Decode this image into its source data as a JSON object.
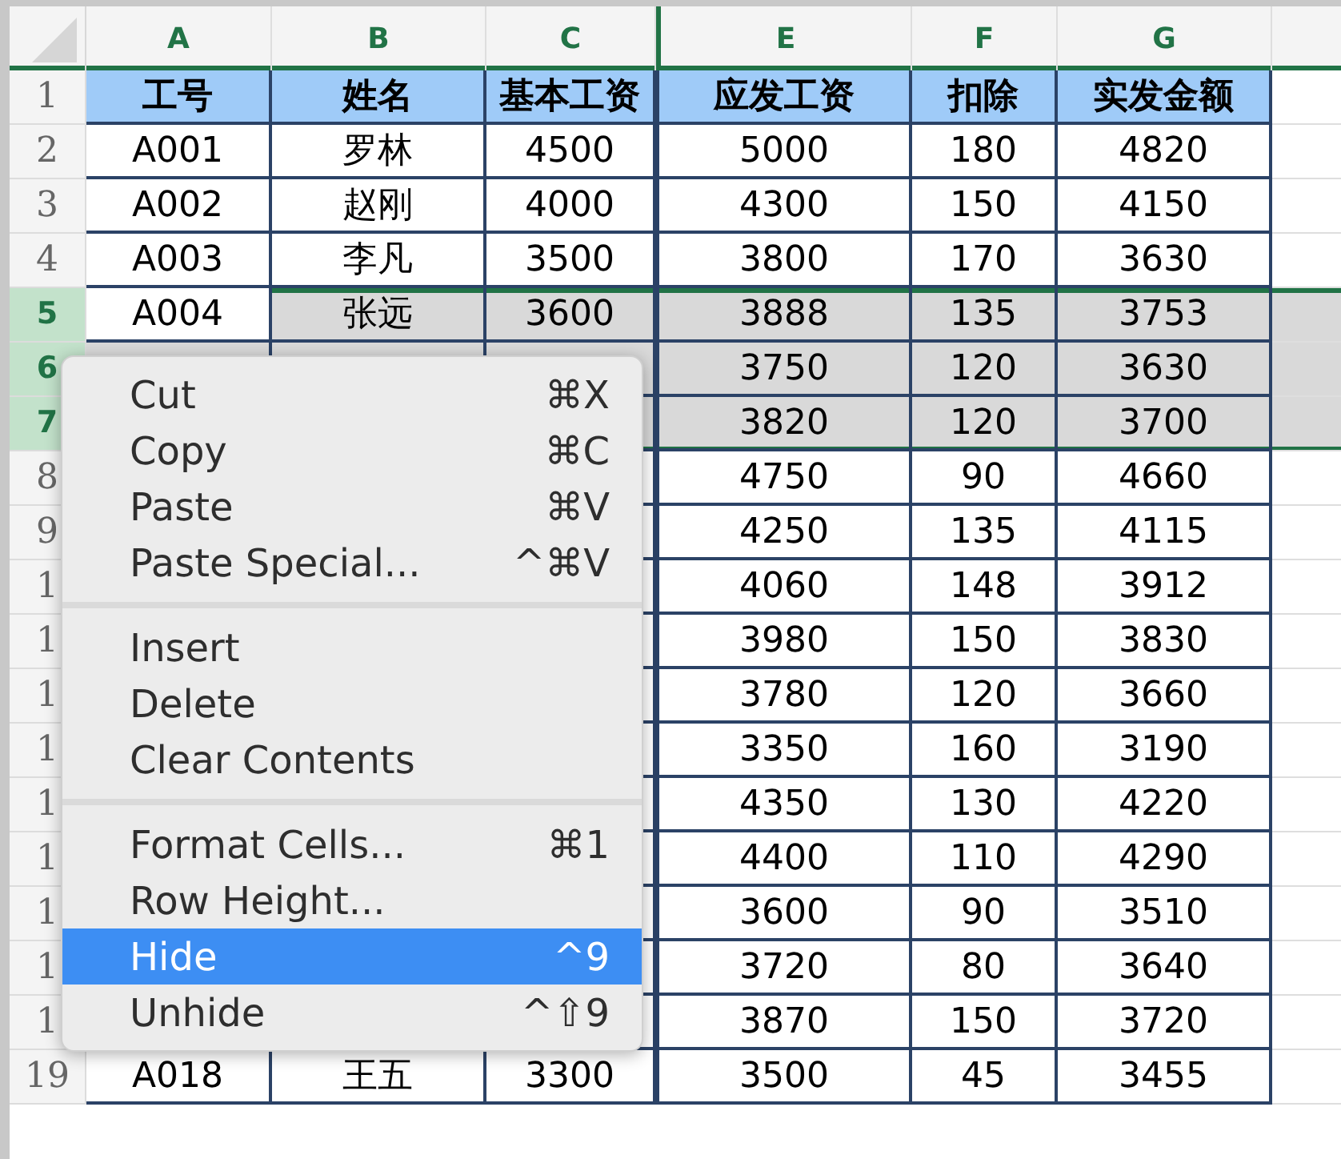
{
  "columns": [
    {
      "label": "A"
    },
    {
      "label": "B"
    },
    {
      "label": "C"
    },
    {
      "label": "E"
    },
    {
      "label": "F"
    },
    {
      "label": "G"
    }
  ],
  "rows": [
    {
      "number": "1",
      "selected": false,
      "heading": true,
      "active_cell": false,
      "cells": [
        "工号",
        "姓名",
        "基本工资",
        "应发工资",
        "扣除",
        "实发金额"
      ]
    },
    {
      "number": "2",
      "selected": false,
      "heading": false,
      "active_cell": false,
      "cells": [
        "A001",
        "罗林",
        "4500",
        "5000",
        "180",
        "4820"
      ]
    },
    {
      "number": "3",
      "selected": false,
      "heading": false,
      "active_cell": false,
      "cells": [
        "A002",
        "赵刚",
        "4000",
        "4300",
        "150",
        "4150"
      ]
    },
    {
      "number": "4",
      "selected": false,
      "heading": false,
      "active_cell": false,
      "cells": [
        "A003",
        "李凡",
        "3500",
        "3800",
        "170",
        "3630"
      ]
    },
    {
      "number": "5",
      "selected": true,
      "heading": false,
      "active_cell": true,
      "cells": [
        "A004",
        "张远",
        "3600",
        "3888",
        "135",
        "3753"
      ]
    },
    {
      "number": "6",
      "selected": true,
      "heading": false,
      "active_cell": false,
      "cells": [
        "3750",
        "120",
        "3630"
      ]
    },
    {
      "number": "7",
      "selected": true,
      "heading": false,
      "active_cell": false,
      "cells": [
        "3820",
        "120",
        "3700"
      ]
    },
    {
      "number": "8",
      "selected": false,
      "heading": false,
      "active_cell": false,
      "cells": [
        "4750",
        "90",
        "4660"
      ]
    },
    {
      "number": "9",
      "selected": false,
      "heading": false,
      "active_cell": false,
      "cells": [
        "4250",
        "135",
        "4115"
      ]
    },
    {
      "number": "1",
      "selected": false,
      "heading": false,
      "active_cell": false,
      "cells": [
        "4060",
        "148",
        "3912"
      ]
    },
    {
      "number": "1",
      "selected": false,
      "heading": false,
      "active_cell": false,
      "cells": [
        "3980",
        "150",
        "3830"
      ]
    },
    {
      "number": "1",
      "selected": false,
      "heading": false,
      "active_cell": false,
      "cells": [
        "3780",
        "120",
        "3660"
      ]
    },
    {
      "number": "1",
      "selected": false,
      "heading": false,
      "active_cell": false,
      "cells": [
        "3350",
        "160",
        "3190"
      ]
    },
    {
      "number": "1",
      "selected": false,
      "heading": false,
      "active_cell": false,
      "cells": [
        "4350",
        "130",
        "4220"
      ]
    },
    {
      "number": "1",
      "selected": false,
      "heading": false,
      "active_cell": false,
      "cells": [
        "4400",
        "110",
        "4290"
      ]
    },
    {
      "number": "1",
      "selected": false,
      "heading": false,
      "active_cell": false,
      "cells": [
        "3600",
        "90",
        "3510"
      ]
    },
    {
      "number": "1",
      "selected": false,
      "heading": false,
      "active_cell": false,
      "cells": [
        "3720",
        "80",
        "3640"
      ]
    },
    {
      "number": "1",
      "selected": false,
      "heading": false,
      "active_cell": false,
      "cells": [
        "3870",
        "150",
        "3720"
      ]
    },
    {
      "number": "19",
      "selected": false,
      "heading": false,
      "active_cell": false,
      "cells": [
        "A018",
        "王五",
        "3300",
        "3500",
        "45",
        "3455"
      ]
    }
  ],
  "context_menu": [
    {
      "kind": "item",
      "label": "Cut",
      "shortcut": "⌘X",
      "selected": false
    },
    {
      "kind": "item",
      "label": "Copy",
      "shortcut": "⌘C",
      "selected": false
    },
    {
      "kind": "item",
      "label": "Paste",
      "shortcut": "⌘V",
      "selected": false
    },
    {
      "kind": "item",
      "label": "Paste Special...",
      "shortcut": "^⌘V",
      "selected": false
    },
    {
      "kind": "separator"
    },
    {
      "kind": "item",
      "label": "Insert",
      "selected": false
    },
    {
      "kind": "item",
      "label": "Delete",
      "selected": false
    },
    {
      "kind": "item",
      "label": "Clear Contents",
      "selected": false
    },
    {
      "kind": "separator"
    },
    {
      "kind": "item",
      "label": "Format Cells...",
      "shortcut": "⌘1",
      "selected": false
    },
    {
      "kind": "item",
      "label": "Row Height...",
      "selected": false
    },
    {
      "kind": "item",
      "label": "Hide",
      "shortcut": "^9",
      "selected": true
    },
    {
      "kind": "item",
      "label": "Unhide",
      "shortcut": "^⇧9",
      "selected": false
    }
  ]
}
